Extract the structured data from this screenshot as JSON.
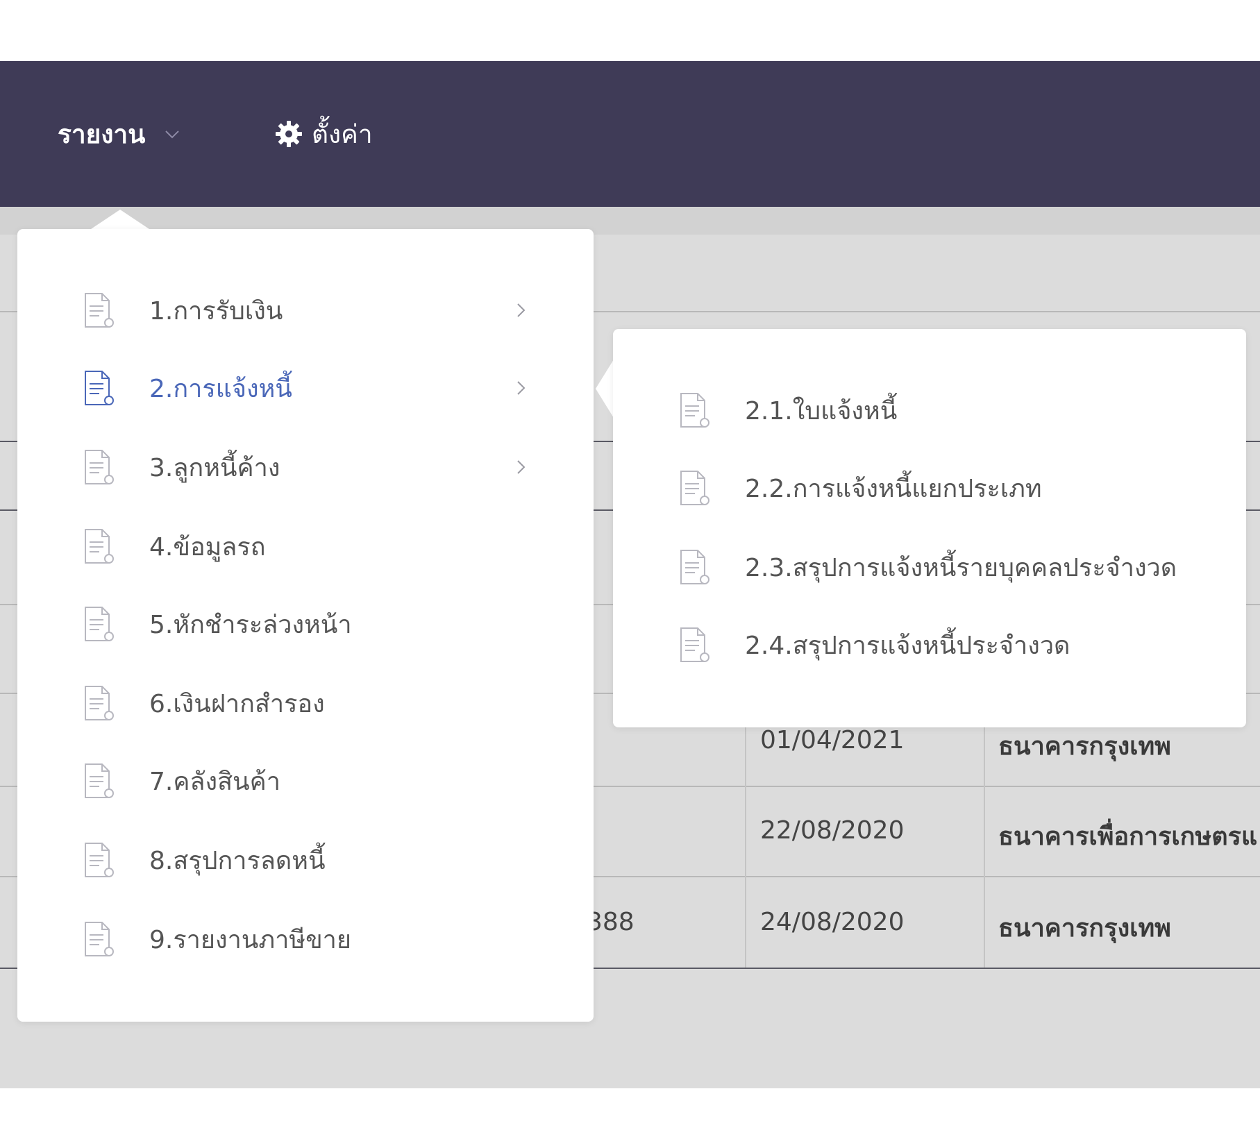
{
  "navbar": {
    "reports_label": "รายงาน",
    "settings_label": "ตั้งค่า",
    "background_color": "#3f3b57"
  },
  "reports_menu": {
    "items": [
      {
        "label": "1.การรับเงิน",
        "has_submenu": true
      },
      {
        "label": "2.การแจ้งหนี้",
        "has_submenu": true,
        "active": true
      },
      {
        "label": "3.ลูกหนี้ค้าง",
        "has_submenu": true
      },
      {
        "label": "4.ข้อมูลรถ",
        "has_submenu": false
      },
      {
        "label": "5.หักชำระล่วงหน้า",
        "has_submenu": false
      },
      {
        "label": "6.เงินฝากสำรอง",
        "has_submenu": false
      },
      {
        "label": "7.คลังสินค้า",
        "has_submenu": false
      },
      {
        "label": "8.สรุปการลดหนี้",
        "has_submenu": false
      },
      {
        "label": "9.รายงานภาษีขาย",
        "has_submenu": false
      }
    ],
    "active_color": "#4a67b8"
  },
  "submenu": {
    "items": [
      {
        "label": "2.1.ใบแจ้งหนี้"
      },
      {
        "label": "2.2.การแจ้งหนี้แยกประเภท"
      },
      {
        "label": "2.3.สรุปการแจ้งหนี้รายบุคคลประจำงวด"
      },
      {
        "label": "2.4.สรุปการแจ้งหนี้ประจำงวด"
      }
    ]
  },
  "background_table": {
    "rows": [
      {
        "amount": "",
        "date": "01/04/2021",
        "bank": "ธนาคารกรุงเทพ"
      },
      {
        "amount": "",
        "date": "22/08/2020",
        "bank": "ธนาคารเพื่อการเกษตรแ"
      },
      {
        "amount": "388",
        "date": "24/08/2020",
        "bank": "ธนาคารกรุงเทพ"
      }
    ]
  }
}
